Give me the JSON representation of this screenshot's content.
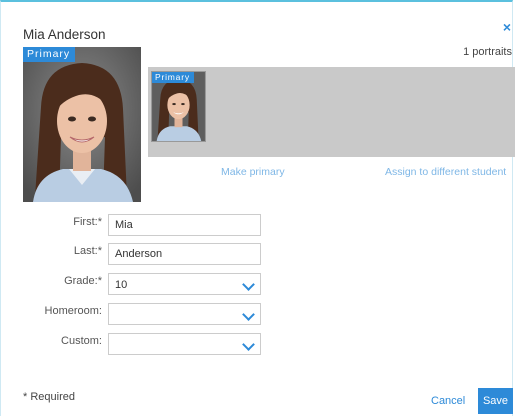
{
  "dialog": {
    "title": "Mia Anderson",
    "close_symbol": "×",
    "portrait_count": "1 portraits"
  },
  "main_portrait": {
    "badge": "Primary"
  },
  "thumbnails": [
    {
      "badge": "Primary"
    }
  ],
  "actions": {
    "make_primary": "Make primary",
    "assign": "Assign to different student"
  },
  "form": {
    "first": {
      "label": "First:*",
      "value": "Mia"
    },
    "last": {
      "label": "Last:*",
      "value": "Anderson"
    },
    "grade": {
      "label": "Grade:*",
      "value": "10"
    },
    "homeroom": {
      "label": "Homeroom:",
      "value": ""
    },
    "custom": {
      "label": "Custom:",
      "value": ""
    }
  },
  "footer": {
    "required_note": "* Required",
    "cancel": "Cancel",
    "save": "Save"
  },
  "colors": {
    "accent": "#2d8ad8",
    "link_light": "#7fb7e6",
    "strip_bg": "#c9c9c9",
    "border_top": "#5bc0de"
  }
}
